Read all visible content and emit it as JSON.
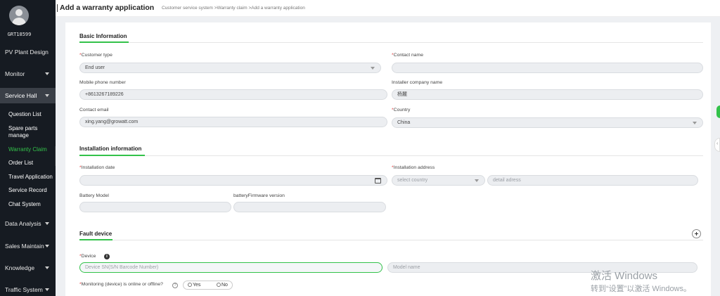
{
  "user": {
    "id": "GRT18599"
  },
  "sidebar": {
    "items": [
      {
        "label": "PV Plant Design"
      },
      {
        "label": "Monitor"
      },
      {
        "label": "Service Hall"
      },
      {
        "label": "Data Analysis"
      },
      {
        "label": "Sales Maintain"
      },
      {
        "label": "Knowledge"
      },
      {
        "label": "Traffic System"
      }
    ],
    "sub_items": [
      {
        "label": "Question List"
      },
      {
        "label": "Spare parts manage"
      },
      {
        "label": "Warranty Claim"
      },
      {
        "label": "Order List"
      },
      {
        "label": "Travel Application"
      },
      {
        "label": "Service Record"
      },
      {
        "label": "Chat System"
      }
    ]
  },
  "header": {
    "title": "Add a warranty application",
    "breadcrumb": "Customer service system >Warranty claim >Add a warranty application"
  },
  "basic": {
    "title": "Basic Information",
    "customer_type_label": "Customer type",
    "customer_type_value": "End user",
    "contact_name_label": "Contact name",
    "contact_name_value": "",
    "mobile_label": "Mobile phone number",
    "mobile_value": "+8613267189226",
    "installer_label": "Installer company name",
    "installer_value": "杨麓",
    "email_label": "Contact email",
    "email_value": "xing.yang@growatt.com",
    "country_label": "Country",
    "country_value": "China"
  },
  "install": {
    "title": "Installation information",
    "date_label": "Installation date",
    "date_value": "",
    "address_label": "Installation address",
    "country_placeholder": "select country",
    "detail_placeholder": "detail adress",
    "battery_model_label": "Battery Model",
    "battery_model_value": "",
    "battery_fw_label": "batteryFirmware version",
    "battery_fw_value": ""
  },
  "fault": {
    "title": "Fault device",
    "device_label": "Device",
    "device_sn_placeholder": "Device SN(S/N Barcode Number)",
    "model_name_placeholder": "Model name",
    "monitoring_label": "Monitoring (device) is online or offline?",
    "yes_label": "Yes",
    "no_label": "No"
  },
  "watermark": {
    "line1": "激活 Windows",
    "line2": "转到“设置”以激活 Windows。"
  },
  "colors": {
    "accent": "#33c24a",
    "sidebar": "#161b22",
    "required": "#e03131"
  }
}
